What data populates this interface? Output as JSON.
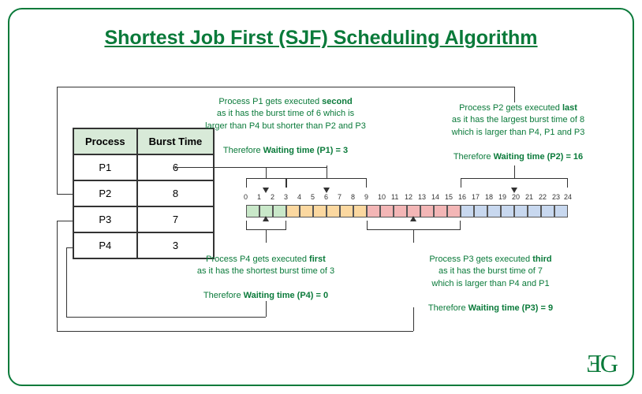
{
  "title": "Shortest Job First (SJF) Scheduling Algorithm",
  "table": {
    "headers": {
      "process": "Process",
      "burst": "Burst Time"
    },
    "rows": [
      {
        "process": "P1",
        "burst": "6"
      },
      {
        "process": "P2",
        "burst": "8"
      },
      {
        "process": "P3",
        "burst": "7"
      },
      {
        "process": "P4",
        "burst": "3"
      }
    ]
  },
  "gantt": {
    "segments": [
      {
        "process": "P4",
        "start": 0,
        "end": 3,
        "color": "c-green"
      },
      {
        "process": "P1",
        "start": 3,
        "end": 9,
        "color": "c-orange"
      },
      {
        "process": "P3",
        "start": 9,
        "end": 16,
        "color": "c-red"
      },
      {
        "process": "P2",
        "start": 16,
        "end": 24,
        "color": "c-blue"
      }
    ],
    "total": 24
  },
  "annotations": {
    "p1": {
      "line1": "Process P1 gets executed",
      "order": "second",
      "line2": "as it has the burst time of 6 which is",
      "line3": "larger than P4 but shorter than P2 and P3",
      "wait_label": "Therefore",
      "wait_value": "Waiting time (P1) = 3"
    },
    "p2": {
      "line1": "Process P2 gets executed",
      "order": "last",
      "line2": "as it has the largest burst time of 8",
      "line3": "which is larger than P4, P1 and P3",
      "wait_label": "Therefore",
      "wait_value": "Waiting time (P2) = 16"
    },
    "p3": {
      "line1": "Process P3 gets executed",
      "order": "third",
      "line2": "as it has the burst time of 7",
      "line3": "which is larger than P4 and P1",
      "wait_label": "Therefore",
      "wait_value": "Waiting time (P3) = 9"
    },
    "p4": {
      "line1": "Process P4 gets executed",
      "order": "first",
      "line2": "as it has the shortest burst time of 3",
      "line3": "",
      "wait_label": "Therefore",
      "wait_value": "Waiting time (P4) = 0"
    }
  },
  "chart_data": {
    "type": "table",
    "title": "Shortest Job First (SJF) Scheduling Algorithm",
    "processes": [
      {
        "name": "P1",
        "burst_time": 6,
        "execution_order": 2,
        "start": 3,
        "end": 9,
        "waiting_time": 3
      },
      {
        "name": "P2",
        "burst_time": 8,
        "execution_order": 4,
        "start": 16,
        "end": 24,
        "waiting_time": 16
      },
      {
        "name": "P3",
        "burst_time": 7,
        "execution_order": 3,
        "start": 9,
        "end": 16,
        "waiting_time": 9
      },
      {
        "name": "P4",
        "burst_time": 3,
        "execution_order": 1,
        "start": 0,
        "end": 3,
        "waiting_time": 0
      }
    ],
    "gantt_ticks": [
      0,
      1,
      2,
      3,
      4,
      5,
      6,
      7,
      8,
      9,
      10,
      11,
      12,
      13,
      14,
      15,
      16,
      17,
      18,
      19,
      20,
      21,
      22,
      23,
      24
    ]
  },
  "logo": "ƎG"
}
